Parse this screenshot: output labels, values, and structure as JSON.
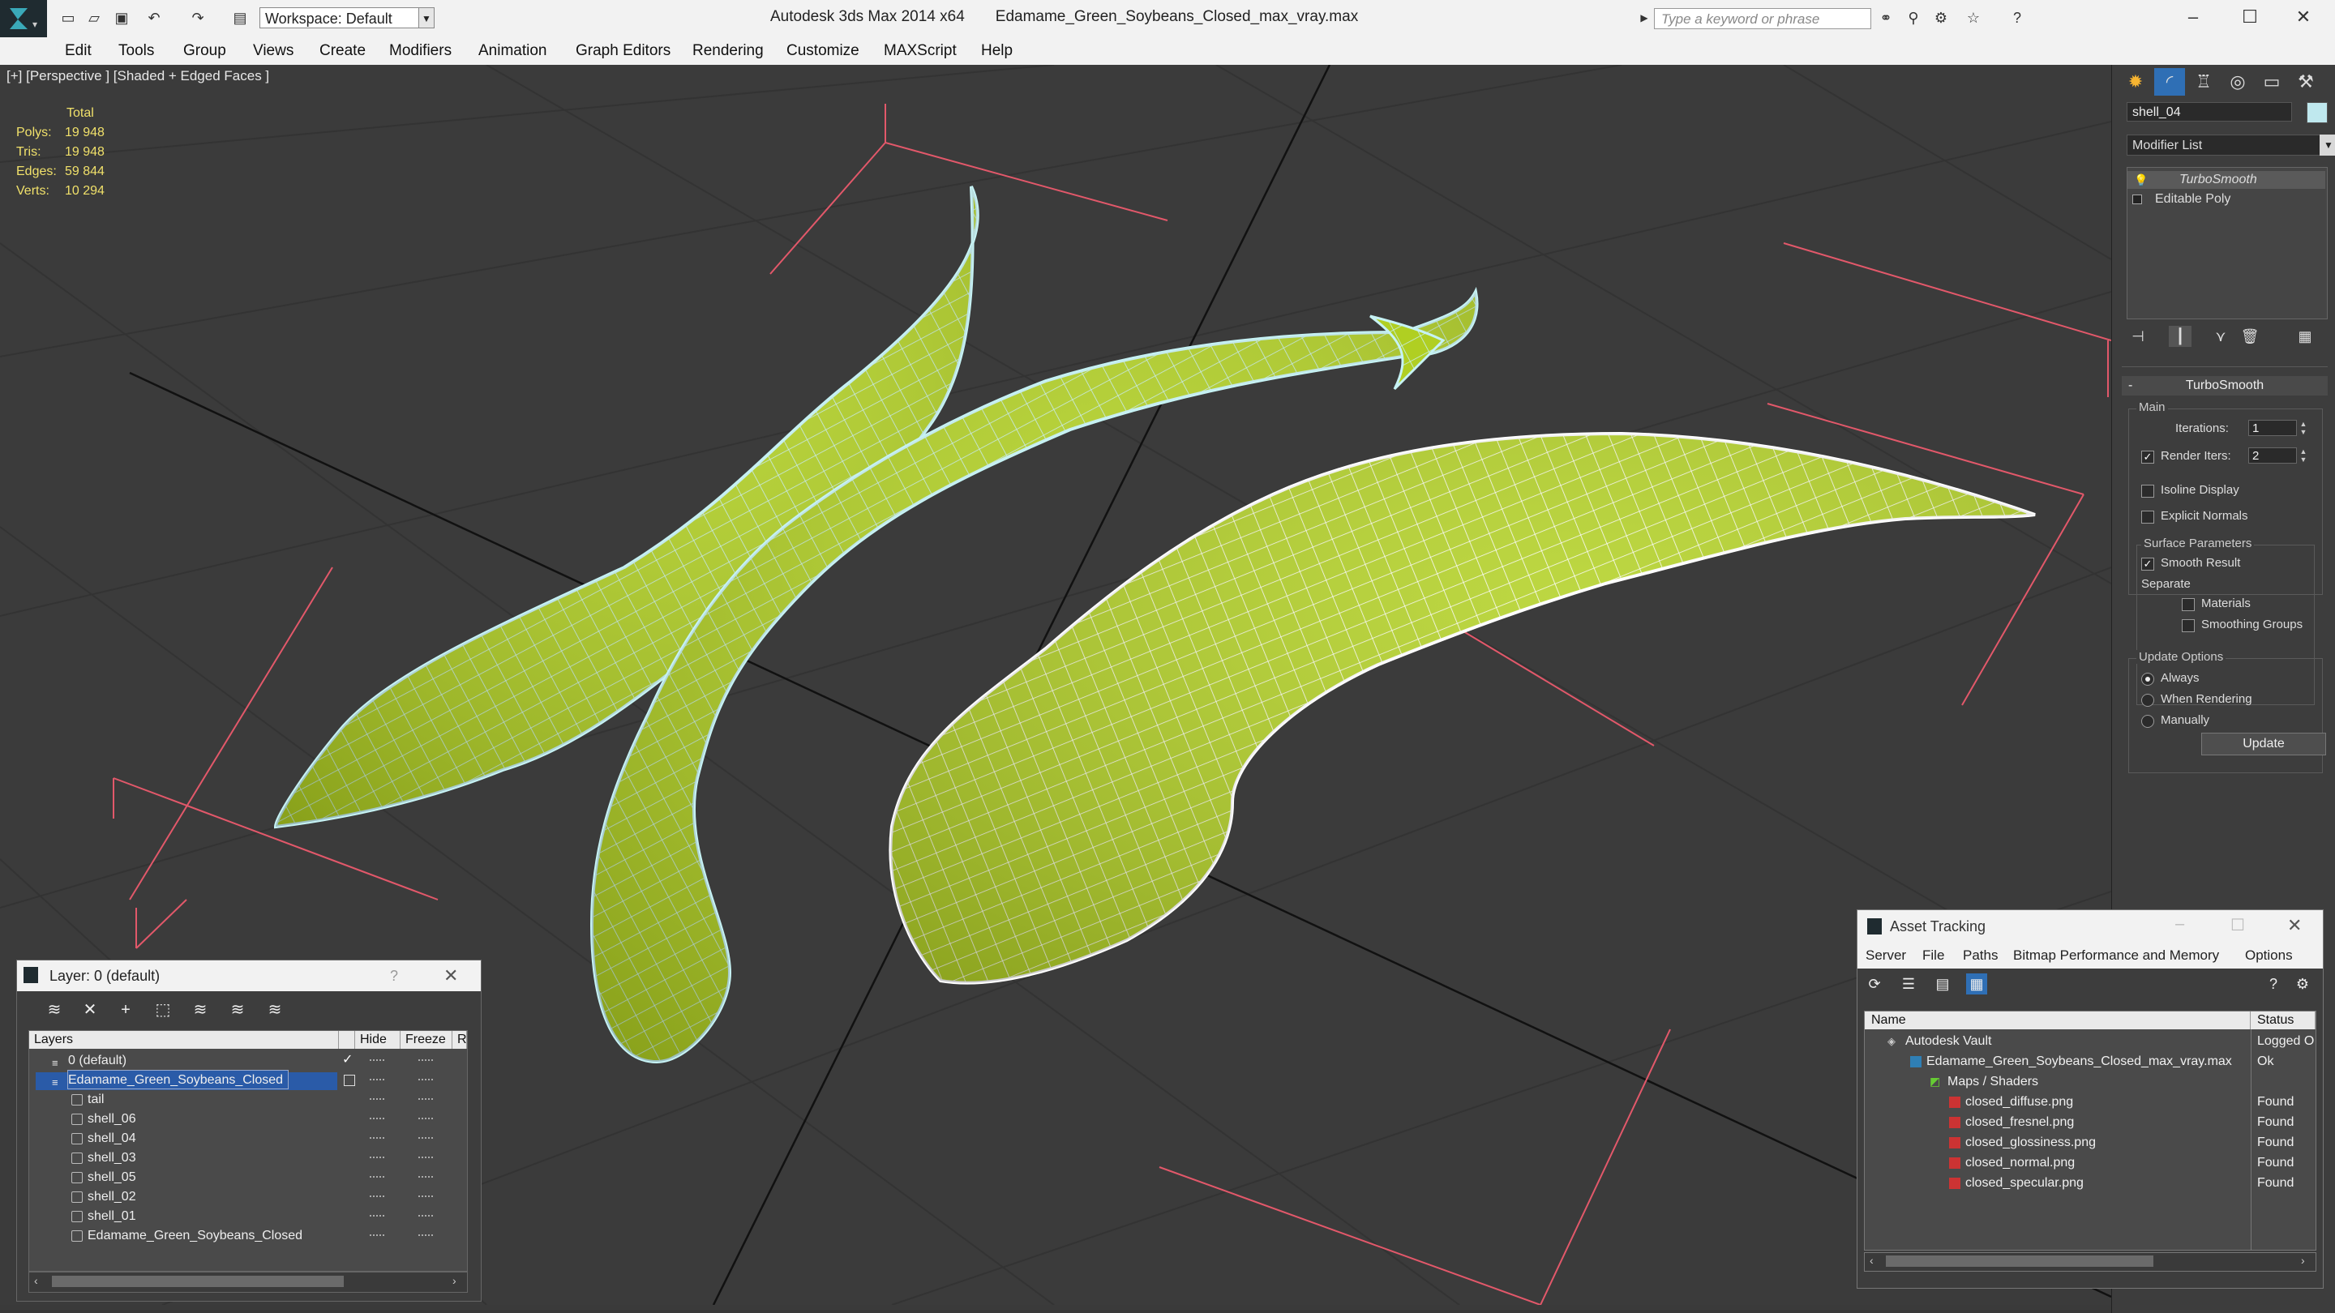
{
  "window": {
    "app_title": "Autodesk 3ds Max 2014 x64",
    "file_name": "Edamame_Green_Soybeans_Closed_max_vray.max",
    "workspace": "Workspace: Default",
    "search_placeholder": "Type a keyword or phrase"
  },
  "menu": [
    "Edit",
    "Tools",
    "Group",
    "Views",
    "Create",
    "Modifiers",
    "Animation",
    "Graph Editors",
    "Rendering",
    "Customize",
    "MAXScript",
    "Help"
  ],
  "viewport": {
    "label": "[+] [Perspective ] [Shaded + Edged Faces ]",
    "stats": {
      "header": "Total",
      "rows": [
        {
          "k": "Polys:",
          "v": "19 948"
        },
        {
          "k": "Tris:",
          "v": "19 948"
        },
        {
          "k": "Edges:",
          "v": "59 844"
        },
        {
          "k": "Verts:",
          "v": "10 294"
        }
      ]
    }
  },
  "command_panel": {
    "object_name": "shell_04",
    "modifier_list": "Modifier List",
    "stack": [
      "TurboSmooth",
      "Editable Poly"
    ],
    "rollout_title": "TurboSmooth",
    "main_group": "Main",
    "iterations_label": "Iterations:",
    "iterations_value": "1",
    "render_iters_label": "Render Iters:",
    "render_iters_value": "2",
    "isoline_label": "Isoline Display",
    "explicit_normals_label": "Explicit Normals",
    "surface_group": "Surface Parameters",
    "smooth_result_label": "Smooth Result",
    "separate_label": "Separate",
    "materials_label": "Materials",
    "smoothing_groups_label": "Smoothing Groups",
    "update_group": "Update Options",
    "always_label": "Always",
    "when_rendering_label": "When Rendering",
    "manually_label": "Manually",
    "update_button": "Update"
  },
  "layer_dialog": {
    "title": "Layer: 0 (default)",
    "help": "?",
    "columns": {
      "layers": "Layers",
      "hide": "Hide",
      "freeze": "Freeze",
      "render": "R"
    },
    "rows": [
      {
        "name": "0 (default)",
        "level": 0
      },
      {
        "name": "Edamame_Green_Soybeans_Closed",
        "level": 0
      },
      {
        "name": "tail",
        "level": 1
      },
      {
        "name": "shell_06",
        "level": 1
      },
      {
        "name": "shell_04",
        "level": 1
      },
      {
        "name": "shell_03",
        "level": 1
      },
      {
        "name": "shell_05",
        "level": 1
      },
      {
        "name": "shell_02",
        "level": 1
      },
      {
        "name": "shell_01",
        "level": 1
      },
      {
        "name": "Edamame_Green_Soybeans_Closed",
        "level": 1
      }
    ]
  },
  "asset_tracking": {
    "title": "Asset Tracking",
    "menu": [
      "Server",
      "File",
      "Paths",
      "Bitmap Performance and Memory",
      "Options"
    ],
    "columns": {
      "name": "Name",
      "status": "Status"
    },
    "rows": [
      {
        "name": "Autodesk Vault",
        "status": "Logged O"
      },
      {
        "name": "Edamame_Green_Soybeans_Closed_max_vray.max",
        "status": "Ok"
      },
      {
        "name": "Maps / Shaders",
        "status": ""
      },
      {
        "name": "closed_diffuse.png",
        "status": "Found"
      },
      {
        "name": "closed_fresnel.png",
        "status": "Found"
      },
      {
        "name": "closed_glossiness.png",
        "status": "Found"
      },
      {
        "name": "closed_normal.png",
        "status": "Found"
      },
      {
        "name": "closed_specular.png",
        "status": "Found"
      }
    ]
  },
  "colors": {
    "pod_fill": "#b5d327",
    "wire_selected": "#bfeef2",
    "wire_unselected": "#ffffff",
    "stats_text": "#f0e06a",
    "selection_blue": "#2a5ba8"
  }
}
